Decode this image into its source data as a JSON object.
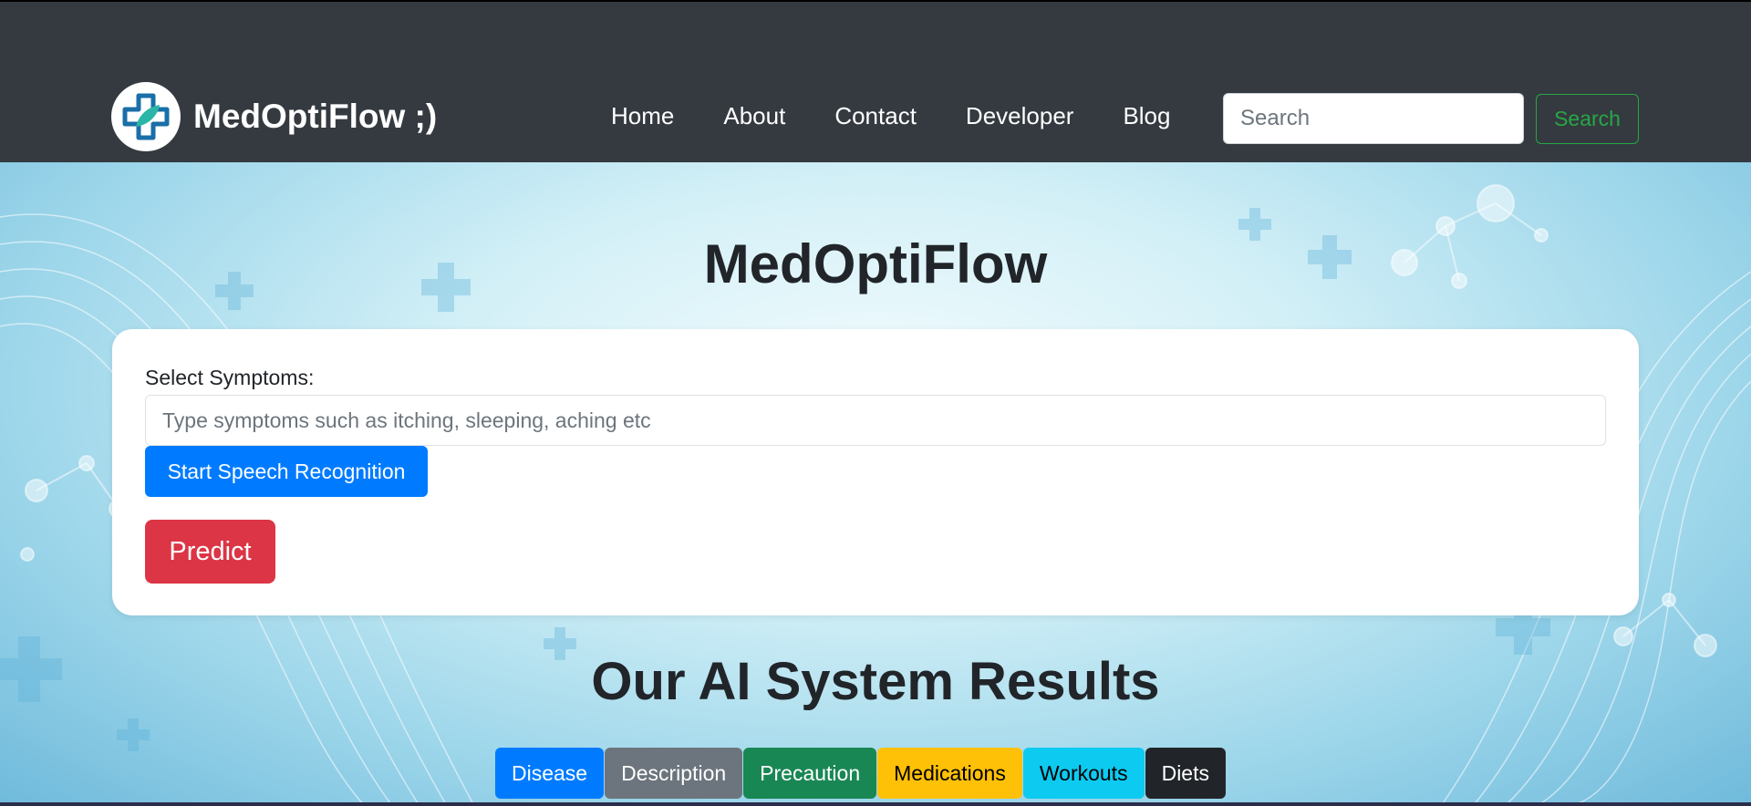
{
  "navbar": {
    "brand": "MedOptiFlow ;)",
    "links": [
      "Home",
      "About",
      "Contact",
      "Developer",
      "Blog"
    ],
    "search_placeholder": "Search",
    "search_button": "Search"
  },
  "hero": {
    "title": "MedOptiFlow"
  },
  "form": {
    "label": "Select Symptoms:",
    "placeholder": "Type symptoms such as itching, sleeping, aching etc",
    "speech_button": "Start Speech Recognition",
    "predict_button": "Predict"
  },
  "results": {
    "title": "Our AI System Results",
    "tabs": [
      {
        "label": "Disease",
        "bg": "#007bff",
        "fg": "#ffffff"
      },
      {
        "label": "Description",
        "bg": "#6c757d",
        "fg": "#ffffff"
      },
      {
        "label": "Precaution",
        "bg": "#198754",
        "fg": "#ffffff"
      },
      {
        "label": "Medications",
        "bg": "#ffc107",
        "fg": "#000000"
      },
      {
        "label": "Workouts",
        "bg": "#0dcaf0",
        "fg": "#000000"
      },
      {
        "label": "Diets",
        "bg": "#212529",
        "fg": "#ffffff"
      }
    ]
  },
  "colors": {
    "navbar_bg": "#343a40",
    "primary": "#007bff",
    "danger": "#dc3545",
    "success": "#28a745"
  }
}
